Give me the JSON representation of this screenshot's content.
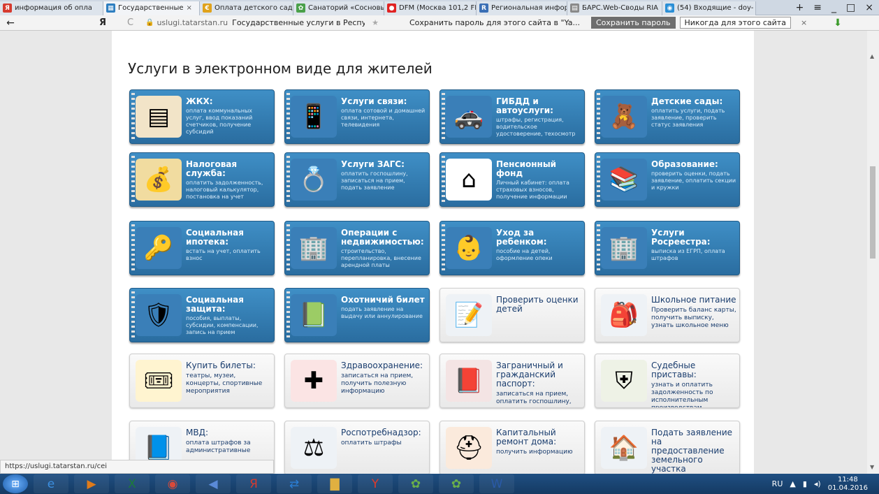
{
  "tabs": [
    {
      "label": "информация об опла",
      "icon": "yandex-icon",
      "color": "#d63b2f",
      "glyph": "Я"
    },
    {
      "label": "Государственные",
      "icon": "gosuslugi-icon",
      "color": "#2f7fc0",
      "glyph": "▦",
      "active": true,
      "close": "×"
    },
    {
      "label": "Оплата детского сада",
      "icon": "doc-icon",
      "color": "#e0a21b",
      "glyph": "€"
    },
    {
      "label": "Санаторий «Сосновы",
      "icon": "sanatorium-icon",
      "color": "#4aa04a",
      "glyph": "✿"
    },
    {
      "label": "DFM (Москва 101,2 FI",
      "icon": "radio-icon",
      "color": "#e02222",
      "glyph": "●"
    },
    {
      "label": "Региональная инфор",
      "icon": "region-icon",
      "color": "#3a6fb5",
      "glyph": "R"
    },
    {
      "label": "БАРС.Web-Своды RIA",
      "icon": "page-icon",
      "color": "#8a8a8a",
      "glyph": "▤"
    },
    {
      "label": "(54) Входящие - doy-",
      "icon": "mail-icon",
      "color": "#2b8fd6",
      "glyph": "◉"
    }
  ],
  "window_controls": {
    "new_tab": "+",
    "menu": "≡",
    "minimize": "_",
    "maximize": "□",
    "close": "×"
  },
  "address": {
    "back": "←",
    "yandex": "Я",
    "reload": "C",
    "host": "uslugi.tatarstan.ru",
    "page_title": "Государственные услуги в Республ...",
    "star": "★",
    "password_prompt": "Сохранить пароль для этого сайта в \"Ya...",
    "save_button": "Сохранить пароль",
    "never_button": "Никогда для этого сайта",
    "close": "×",
    "download": "⬇"
  },
  "heading": "Услуги в электронном виде для жителей",
  "cards": [
    {
      "name": "zhkh",
      "style": "blue",
      "title": "ЖКХ:",
      "sub": "оплата коммунальных услуг, ввод показаний счетчиков, получение субсидий",
      "icon": "invoice-icon",
      "glyph": "▤",
      "bg": "#f2e4c8"
    },
    {
      "name": "communication",
      "style": "blue",
      "title": "Услуги связи:",
      "sub": "оплата сотовой и домашней связи, интернета, телевидения",
      "icon": "phone-icon",
      "glyph": "📱",
      "bg": "#3a7fb8"
    },
    {
      "name": "gibdd",
      "style": "blue",
      "title": "ГИБДД и автоуслуги:",
      "sub": "штрафы, регистрация, водительское удостоверение, техосмотр",
      "icon": "police-cap-icon",
      "glyph": "🚓",
      "bg": "#3a7fb8"
    },
    {
      "name": "kindergarten",
      "style": "blue",
      "title": "Детские сады:",
      "sub": "оплатить услуги, подать заявление, проверить статус заявления",
      "icon": "teddy-bear-icon",
      "glyph": "🧸",
      "bg": "#3a7fb8"
    },
    {
      "name": "tax",
      "style": "blue",
      "title": "Налоговая служба:",
      "sub": "оплатить задолженность, налоговый калькулятор, постановка на учет",
      "icon": "coins-icon",
      "glyph": "💰",
      "bg": "#f1dca0"
    },
    {
      "name": "zags",
      "style": "blue",
      "title": "Услуги ЗАГС:",
      "sub": "оплатить госпошлину, записаться на прием, подать заявление",
      "icon": "rings-icon",
      "glyph": "💍",
      "bg": "#3a7fb8"
    },
    {
      "name": "pension",
      "style": "blue",
      "title": "Пенсионный фонд",
      "sub": "Личный кабинет: оплата страховых взносов, получение информации",
      "icon": "pfr-logo-icon",
      "glyph": "⌂",
      "bg": "#ffffff"
    },
    {
      "name": "education",
      "style": "blue",
      "title": "Образование:",
      "sub": "проверить оценки, подать заявление, оплатить секции и кружки",
      "icon": "book-globe-icon",
      "glyph": "📚",
      "bg": "#3a7fb8"
    },
    {
      "name": "social-mortgage",
      "style": "blue",
      "title": "Социальная ипотека:",
      "sub": "встать на учет, оплатить взнос",
      "icon": "keys-icon",
      "glyph": "🔑",
      "bg": "#3a7fb8"
    },
    {
      "name": "real-estate",
      "style": "blue",
      "title": "Операции с недвижимостью:",
      "sub": "строительство, перепланировка, внесение арендной платы",
      "icon": "building-icon",
      "glyph": "🏢",
      "bg": "#3a7fb8"
    },
    {
      "name": "child-care",
      "style": "blue",
      "title": "Уход за ребенком:",
      "sub": "пособие на детей, оформление опеки",
      "icon": "baby-icon",
      "glyph": "👶",
      "bg": "#3a7fb8"
    },
    {
      "name": "rosreestr",
      "style": "blue",
      "title": "Услуги Росреестра:",
      "sub": "выписка из ЕГРП, оплата штрафов",
      "icon": "building-keys-icon",
      "glyph": "🏢",
      "bg": "#3a7fb8"
    },
    {
      "name": "social-protection",
      "style": "blue",
      "title": "Социальная защита:",
      "sub": "пособия, выплаты, субсидии, компенсации, запись на прием",
      "icon": "shield-people-icon",
      "glyph": "🛡",
      "bg": "#3a7fb8"
    },
    {
      "name": "hunting",
      "style": "blue",
      "title": "Охотничий билет",
      "sub": "подать заявление на выдачу или аннулирование",
      "icon": "hunting-license-icon",
      "glyph": "📗",
      "bg": "#3a7fb8"
    },
    {
      "name": "grades",
      "style": "light",
      "title": "Проверить оценки детей",
      "sub": "",
      "icon": "notebook-icon",
      "glyph": "📝",
      "bg": "#eef2f6"
    },
    {
      "name": "school-meals",
      "style": "light",
      "title": "Школьное питание",
      "sub": "Проверить баланс карты, получить выписку, узнать школьное меню",
      "icon": "backpack-icon",
      "glyph": "🎒",
      "bg": "#eef2f6"
    },
    {
      "name": "tickets",
      "style": "light",
      "title": "Купить билеты:",
      "sub": "театры, музеи, концерты, спортивные мероприятия",
      "icon": "tickets-icon",
      "glyph": "🎟",
      "bg": "#fff4d0"
    },
    {
      "name": "health",
      "style": "light",
      "title": "Здравоохранение:",
      "sub": "записаться на прием, получить полезную информацию",
      "icon": "medical-cross-icon",
      "glyph": "✚",
      "bg": "#fbe4e4"
    },
    {
      "name": "passport",
      "style": "light",
      "title": "Заграничный и гражданский паспорт:",
      "sub": "записаться на прием, оплатить госпошлину, узнать о готовности",
      "icon": "passport-icon",
      "glyph": "📕",
      "bg": "#f4e4e4"
    },
    {
      "name": "bailiffs",
      "style": "light",
      "title": "Судебные приставы:",
      "sub": "узнать и оплатить задолженность по исполнительным производствам",
      "icon": "bailiff-badge-icon",
      "glyph": "⛨",
      "bg": "#eef2e6"
    },
    {
      "name": "mvd",
      "style": "light",
      "title": "МВД:",
      "sub": "оплата штрафов за административные",
      "icon": "mvd-book-icon",
      "glyph": "📘",
      "bg": "#eef2f6"
    },
    {
      "name": "rospotrebnadzor",
      "style": "light",
      "title": "Роспотребнадзор:",
      "sub": "оплатить штрафы",
      "icon": "scales-icon",
      "glyph": "⚖",
      "bg": "#eef2f6"
    },
    {
      "name": "capital-repair",
      "style": "light",
      "title": "Капитальный ремонт дома:",
      "sub": "получить информацию",
      "icon": "hard-hat-icon",
      "glyph": "⛑",
      "bg": "#fbeadc"
    },
    {
      "name": "land",
      "style": "light",
      "title": "Подать заявление на предоставление земельного участка многодетной семье",
      "sub": "",
      "icon": "family-house-icon",
      "glyph": "🏠",
      "bg": "#eef2f6"
    }
  ],
  "status_url": "https://uslugi.tatarstan.ru/cei",
  "taskbar": {
    "apps": [
      {
        "name": "ie-icon",
        "glyph": "e",
        "color": "#3b8fe0"
      },
      {
        "name": "media-icon",
        "glyph": "▶",
        "color": "#e07b1a"
      },
      {
        "name": "excel-icon",
        "glyph": "X",
        "color": "#1d7a3a"
      },
      {
        "name": "chrome-icon",
        "glyph": "◉",
        "color": "#d84a3a"
      },
      {
        "name": "volume-app-icon",
        "glyph": "◀",
        "color": "#5a8ad8"
      },
      {
        "name": "yandex-app-icon",
        "glyph": "Я",
        "color": "#d63b2f"
      },
      {
        "name": "teamviewer-icon",
        "glyph": "⇄",
        "color": "#2b7fd6"
      },
      {
        "name": "explorer-icon",
        "glyph": "▇",
        "color": "#e0b040"
      },
      {
        "name": "yandex-browser-icon",
        "glyph": "Y",
        "color": "#e03a2a"
      },
      {
        "name": "kids-app-icon",
        "glyph": "✿",
        "color": "#6ab04a"
      },
      {
        "name": "kids-app2-icon",
        "glyph": "✿",
        "color": "#6ab04a"
      },
      {
        "name": "word-icon",
        "glyph": "W",
        "color": "#2a5aa8"
      }
    ],
    "lang": "RU",
    "time": "11:48",
    "date": "01.04.2016"
  }
}
